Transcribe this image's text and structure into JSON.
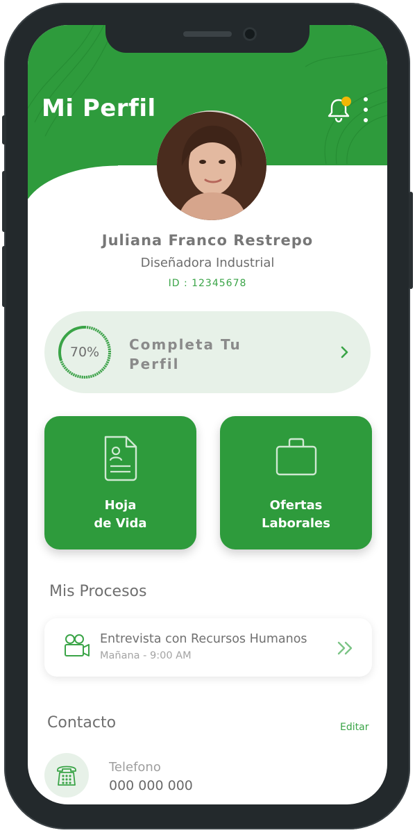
{
  "header": {
    "title": "Mi Perfil",
    "notification_icon": "bell-icon",
    "more_icon": "kebab-menu-icon"
  },
  "profile": {
    "name": "Juliana Franco Restrepo",
    "role": "Diseñadora Industrial",
    "id": "ID : 12345678"
  },
  "complete_profile": {
    "percent": "70%",
    "progress": 0.7,
    "label": "Completa Tu Perfil",
    "icon": "chevron-right-icon"
  },
  "cards": [
    {
      "label_line1": "Hoja",
      "label_line2": "de Vida",
      "icon": "resume-document-icon"
    },
    {
      "label_line1": "Ofertas",
      "label_line2": "Laborales",
      "icon": "briefcase-icon"
    }
  ],
  "processes": {
    "title": "Mis Procesos",
    "items": [
      {
        "title": "Entrevista con Recursos Humanos",
        "time": "Mañana - 9:00 AM",
        "icon": "video-camera-icon",
        "action_icon": "double-chevron-right-icon"
      }
    ]
  },
  "contact": {
    "title": "Contacto",
    "edit_label": "Editar",
    "phone_label": "Telefono",
    "phone_value": "000 000 000",
    "phone_icon": "telephone-icon"
  },
  "colors": {
    "brand_green": "#2e9b3c",
    "accent_text_green": "#3aa447",
    "light_green": "#e7f1e8",
    "notification_dot": "#f2b705"
  }
}
